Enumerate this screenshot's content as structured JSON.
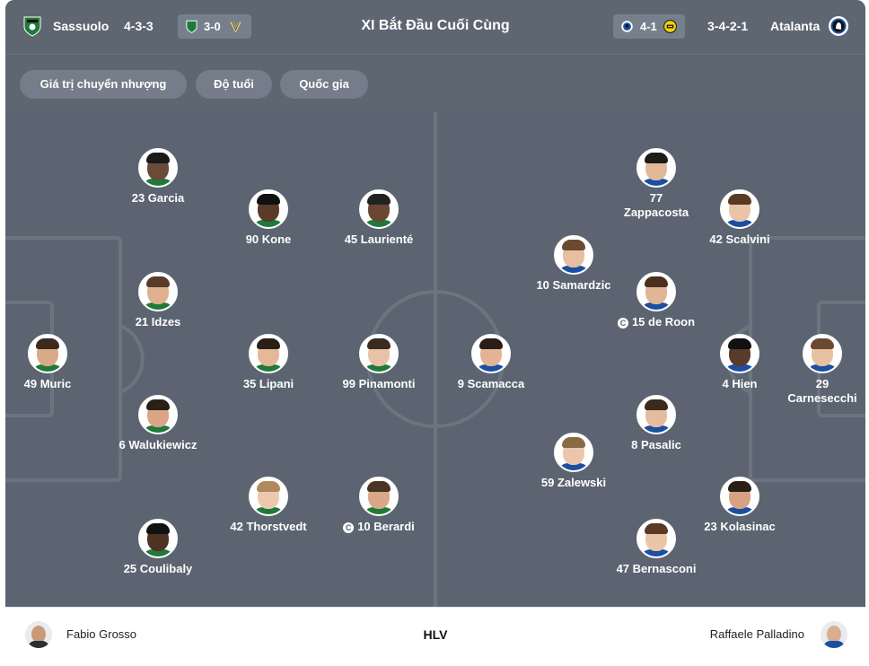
{
  "header": {
    "home_team": "Sassuolo",
    "home_formation": "4-3-3",
    "home_last_score": "3-0",
    "title": "XI Bắt Đầu Cuối Cùng",
    "away_last_score": "4-1",
    "away_formation": "3-4-2-1",
    "away_team": "Atalanta",
    "home_crest_icon": "sassuolo-crest-icon",
    "away_crest_icon": "atalanta-crest-icon",
    "home_opponent_icon": "verona-crest-icon",
    "away_opponent_icon": "dortmund-crest-icon"
  },
  "filters": [
    "Giá trị chuyển nhượng",
    "Độ tuổi",
    "Quốc gia"
  ],
  "home_players": [
    {
      "label": "23 Garcia",
      "captain": false
    },
    {
      "label": "90 Kone",
      "captain": false
    },
    {
      "label": "45 Laurienté",
      "captain": false
    },
    {
      "label": "21 Idzes",
      "captain": false
    },
    {
      "label": "49 Muric",
      "captain": false
    },
    {
      "label": "35 Lipani",
      "captain": false
    },
    {
      "label": "99 Pinamonti",
      "captain": false
    },
    {
      "label": "6 Walukiewicz",
      "captain": false
    },
    {
      "label": "42 Thorstvedt",
      "captain": false
    },
    {
      "label": "10 Berardi",
      "captain": true
    },
    {
      "label": "25 Coulibaly",
      "captain": false
    }
  ],
  "away_players": [
    {
      "label": "77 Zappacosta",
      "captain": false
    },
    {
      "label": "42 Scalvini",
      "captain": false
    },
    {
      "label": "10 Samardzic",
      "captain": false
    },
    {
      "label": "15 de Roon",
      "captain": true
    },
    {
      "label": "9 Scamacca",
      "captain": false
    },
    {
      "label": "4 Hien",
      "captain": false
    },
    {
      "label": "29 Carnesecchi",
      "captain": false
    },
    {
      "label": "8 Pasalic",
      "captain": false
    },
    {
      "label": "59 Zalewski",
      "captain": false
    },
    {
      "label": "23 Kolasinac",
      "captain": false
    },
    {
      "label": "47 Bernasconi",
      "captain": false
    }
  ],
  "captain_mark": "C",
  "footer": {
    "home_coach": "Fabio Grosso",
    "label": "HLV",
    "away_coach": "Raffaele Palladino"
  },
  "colors": {
    "header_bg": "#5e6672",
    "pitch_bg": "#5b6470",
    "line": "#6c7480",
    "sassuolo_green": "#1f7a3a",
    "atalanta_blue": "#1b4fa0",
    "dortmund_yellow": "#f5d10a",
    "verona_yellow": "#f2c94c"
  }
}
